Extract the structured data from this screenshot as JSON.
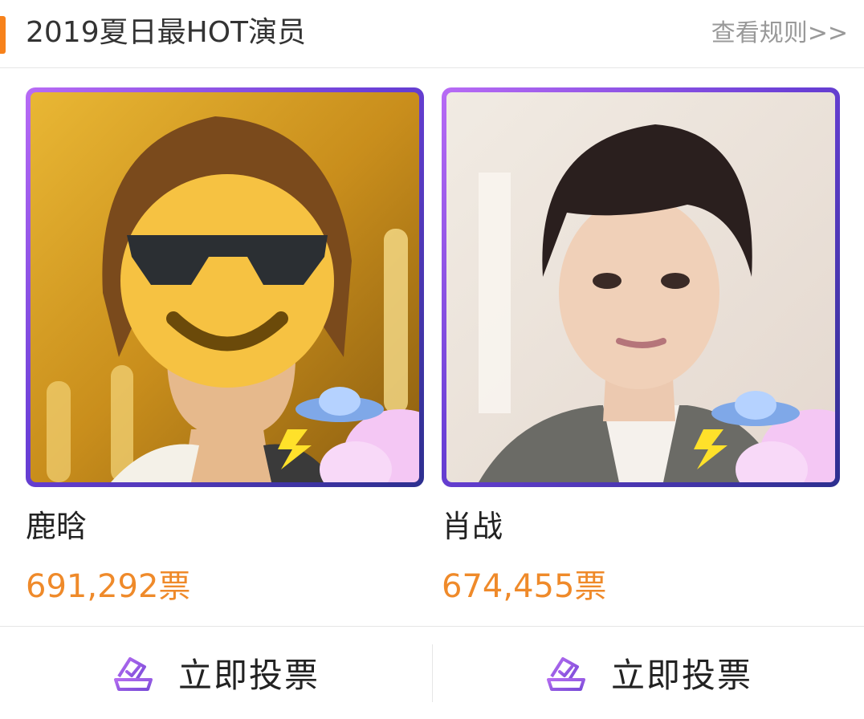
{
  "header": {
    "title": "2019夏日最HOT演员",
    "rules_link": "查看规则>>",
    "accent_color": "#f7821b"
  },
  "candidates": [
    {
      "name": "鹿晗",
      "votes": "691,292票",
      "photo_icon": "ufo-icon"
    },
    {
      "name": "肖战",
      "votes": "674,455票",
      "photo_icon": "ufo-icon"
    }
  ],
  "actions": [
    {
      "label": "立即投票",
      "icon": "ballot-icon"
    },
    {
      "label": "立即投票",
      "icon": "ballot-icon"
    }
  ],
  "colors": {
    "vote_count": "#ef8a2a",
    "frame_gradient": [
      "#b86bf5",
      "#2d2f8f"
    ]
  }
}
